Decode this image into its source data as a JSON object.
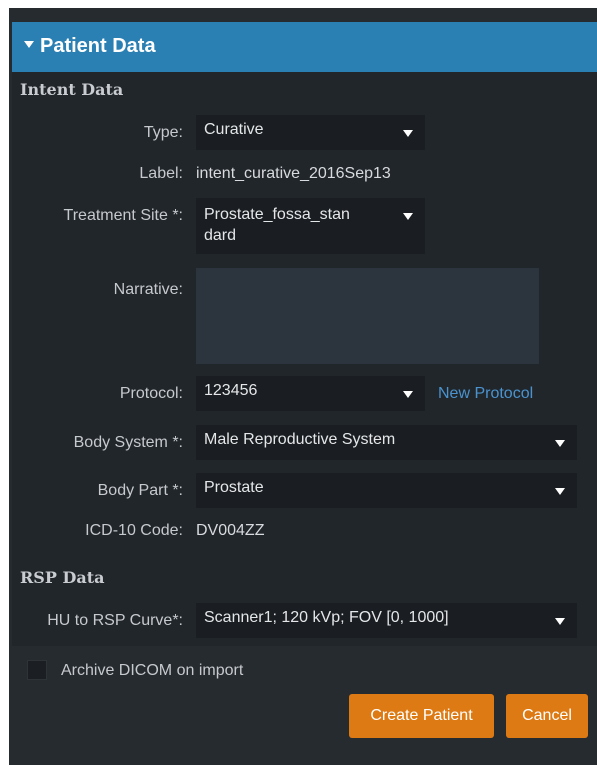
{
  "panel": {
    "title": "Patient Data"
  },
  "intent": {
    "section_title": "Intent Data",
    "type_label": "Type:",
    "type_value": "Curative",
    "label_label": "Label:",
    "label_value": "intent_curative_2016Sep13",
    "site_label": "Treatment Site *:",
    "site_value_line1": "Prostate_fossa_stan",
    "site_value_line2": "dard",
    "narrative_label": "Narrative:",
    "narrative_value": "",
    "protocol_label": "Protocol:",
    "protocol_value": "123456",
    "new_protocol_link": "New Protocol",
    "body_system_label": "Body System *:",
    "body_system_value": "Male Reproductive System",
    "body_part_label": "Body Part *:",
    "body_part_value": "Prostate",
    "icd_label": "ICD-10 Code:",
    "icd_value": "DV004ZZ"
  },
  "rsp": {
    "section_title": "RSP Data",
    "curve_label": "HU to RSP Curve*:",
    "curve_value": "Scanner1; 120 kVp; FOV [0, 1000]"
  },
  "footer": {
    "archive_label": "Archive DICOM on import",
    "archive_checked": false,
    "create_button": "Create Patient",
    "cancel_button": "Cancel"
  },
  "colors": {
    "header": "#2a7fb3",
    "accent_button": "#de7a14",
    "link": "#4a93cf"
  }
}
